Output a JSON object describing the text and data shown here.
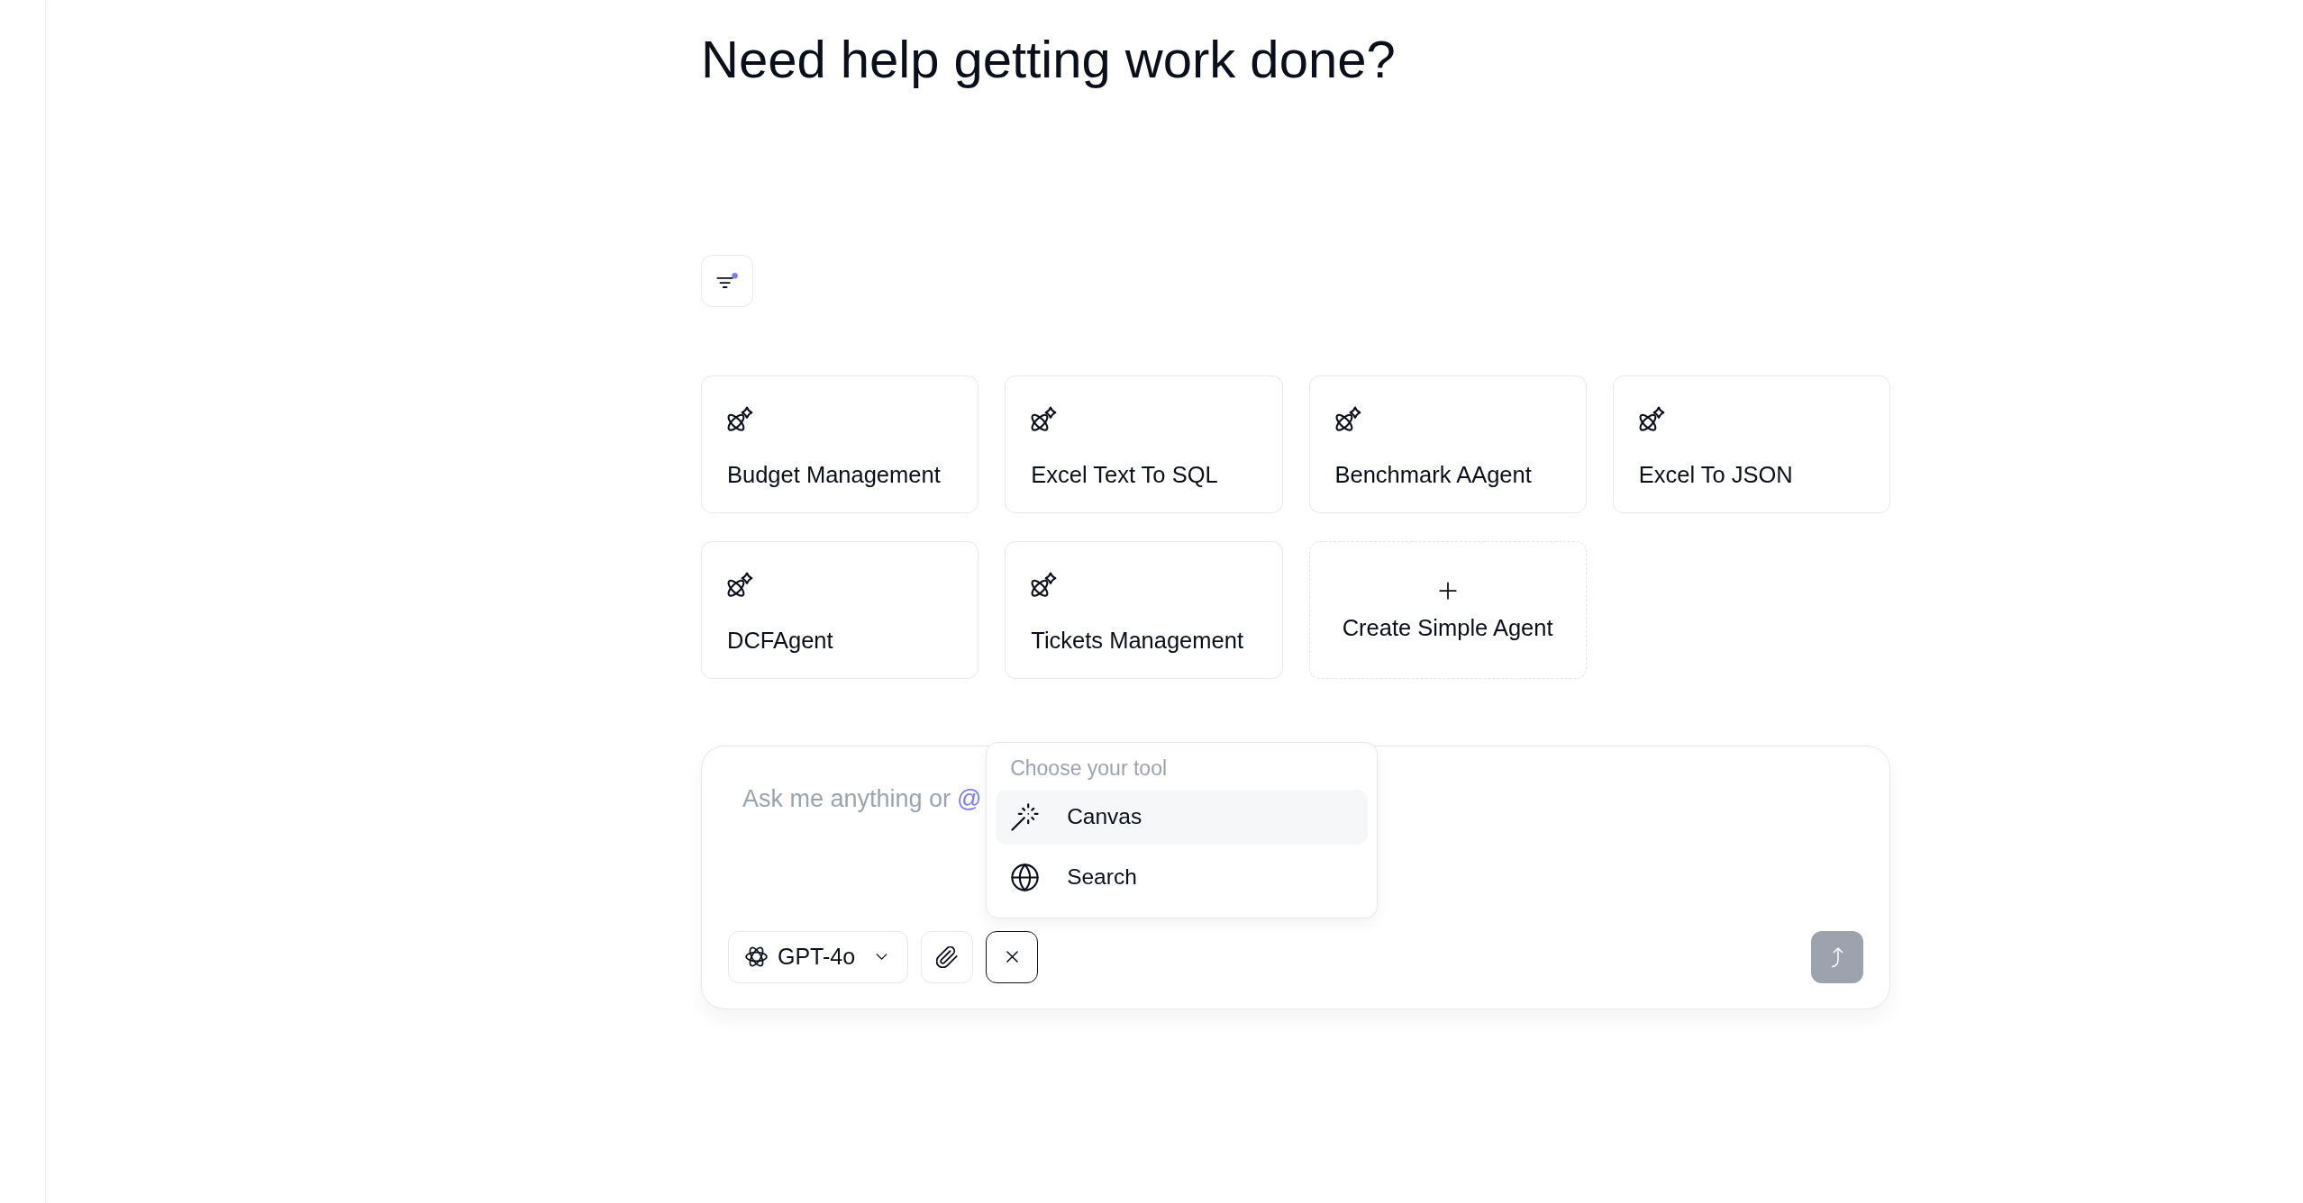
{
  "heading": "Need help getting work done?",
  "agents": [
    {
      "name": "Budget Management"
    },
    {
      "name": "Excel Text To SQL"
    },
    {
      "name": "Benchmark AAgent"
    },
    {
      "name": "Excel To JSON"
    },
    {
      "name": "DCFAgent"
    },
    {
      "name": "Tickets Management"
    }
  ],
  "create_agent": {
    "label": "Create Simple Agent"
  },
  "composer": {
    "placeholder": "Ask me anything or",
    "mention_symbol": "@",
    "model": "GPT-4o",
    "send_button": {
      "disabled": true
    }
  },
  "tool_menu": {
    "open": true,
    "title": "Choose your tool",
    "items": [
      {
        "label": "Canvas",
        "kind": "canvas",
        "selected": true
      },
      {
        "label": "Search",
        "kind": "search",
        "selected": false
      }
    ]
  }
}
